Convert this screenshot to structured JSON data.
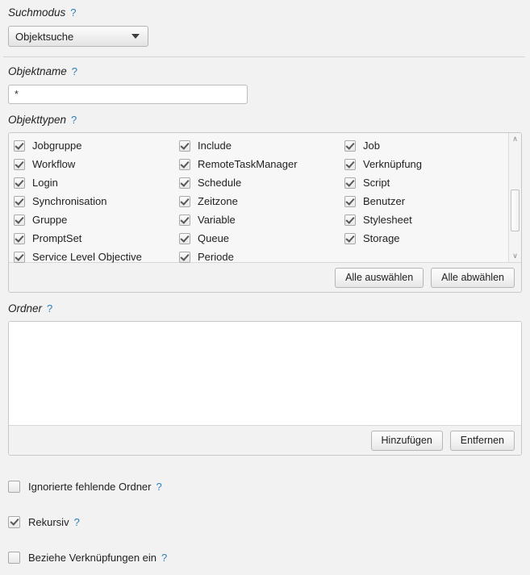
{
  "help_glyph": "?",
  "search_mode": {
    "label": "Suchmodus",
    "selected": "Objektsuche"
  },
  "object_name": {
    "label": "Objektname",
    "value": "*"
  },
  "object_types": {
    "label": "Objekttypen",
    "columns": [
      [
        {
          "label": "Jobgruppe",
          "checked": true
        },
        {
          "label": "Workflow",
          "checked": true
        },
        {
          "label": "Login",
          "checked": true
        },
        {
          "label": "Synchronisation",
          "checked": true
        },
        {
          "label": "Gruppe",
          "checked": true
        },
        {
          "label": "PromptSet",
          "checked": true
        },
        {
          "label": "Service Level Objective",
          "checked": true
        }
      ],
      [
        {
          "label": "Include",
          "checked": true
        },
        {
          "label": "RemoteTaskManager",
          "checked": true
        },
        {
          "label": "Schedule",
          "checked": true
        },
        {
          "label": "Zeitzone",
          "checked": true
        },
        {
          "label": "Variable",
          "checked": true
        },
        {
          "label": "Queue",
          "checked": true
        },
        {
          "label": "Periode",
          "checked": true
        }
      ],
      [
        {
          "label": "Job",
          "checked": true
        },
        {
          "label": "Verknüpfung",
          "checked": true
        },
        {
          "label": "Script",
          "checked": true
        },
        {
          "label": "Benutzer",
          "checked": true
        },
        {
          "label": "Stylesheet",
          "checked": true
        },
        {
          "label": "Storage",
          "checked": true
        }
      ]
    ],
    "select_all_label": "Alle auswählen",
    "deselect_all_label": "Alle abwählen",
    "scroll_up_glyph": "∧",
    "scroll_down_glyph": "∨"
  },
  "folders": {
    "label": "Ordner",
    "items": [],
    "add_label": "Hinzufügen",
    "remove_label": "Entfernen"
  },
  "options": [
    {
      "label": "Ignorierte fehlende Ordner",
      "checked": false
    },
    {
      "label": "Rekursiv",
      "checked": true
    },
    {
      "label": "Beziehe Verknüpfungen ein",
      "checked": false
    }
  ],
  "colors": {
    "background": "#f2f2f2",
    "help_link": "#2c7fb8",
    "panel_border": "#c8c8c8"
  }
}
